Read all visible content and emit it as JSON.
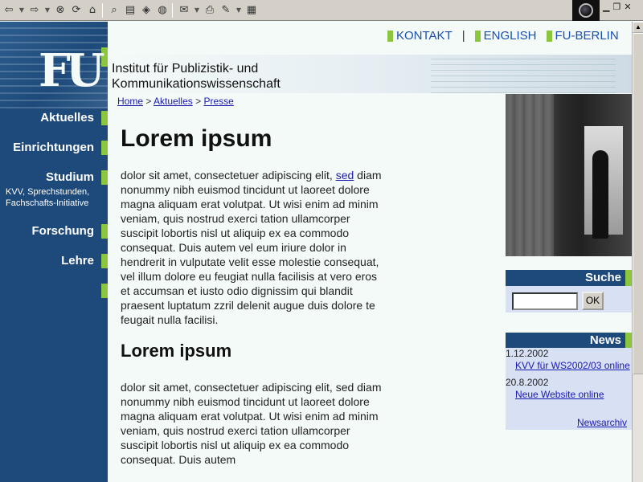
{
  "toolbar": {
    "buttons": [
      "back-icon",
      "forward-icon",
      "stop-icon",
      "reload-icon",
      "home-icon",
      "search-icon",
      "folder-icon",
      "history-icon",
      "mail-icon",
      "edit-icon",
      "print-icon",
      "edit-page-icon",
      "page-icon"
    ]
  },
  "header": {
    "topnav": [
      {
        "label": "KONTAKT"
      },
      {
        "label": "ENGLISH"
      },
      {
        "label": "FU-BERLIN"
      }
    ],
    "logo_text": "FU",
    "institute_line1": "Institut für Publizistik- und",
    "institute_line2": "Kommunikationswissenschaft"
  },
  "breadcrumb": {
    "home": "Home",
    "aktuelles": "Aktuelles",
    "presse": "Presse",
    "sep": ">"
  },
  "sidebar": {
    "items": [
      {
        "label": "Aktuelles"
      },
      {
        "label": "Einrichtungen"
      },
      {
        "label": "Studium",
        "sub1": "KVV, Sprechstunden,",
        "sub2": "Fachschafts-Initiative"
      },
      {
        "label": "Forschung"
      },
      {
        "label": "Lehre"
      }
    ]
  },
  "main": {
    "heading1": "Lorem ipsum",
    "para1_before_link": "dolor sit amet, consectetuer adipiscing elit, ",
    "para1_link": "sed",
    "para1_after_link": " diam nonummy nibh euismod tincidunt ut laoreet dolore magna aliquam erat volutpat. Ut wisi enim ad minim veniam, quis nostrud exerci tation ullamcorper suscipit lobortis nisl ut aliquip ex ea commodo consequat. Duis autem vel eum iriure dolor in hendrerit in vulputate velit esse molestie consequat, vel illum dolore eu feugiat nulla facilisis at vero eros et accumsan et iusto odio dignissim qui blandit praesent luptatum zzril delenit augue duis dolore te feugait nulla facilisi.",
    "heading2": "Lorem ipsum",
    "para2": "dolor sit amet, consectetuer adipiscing elit, sed diam nonummy nibh euismod tincidunt ut laoreet dolore magna aliquam erat volutpat. Ut wisi enim ad minim veniam, quis nostrud exerci tation ullamcorper suscipit lobortis nisl ut aliquip ex ea commodo consequat. Duis autem"
  },
  "search": {
    "title": "Suche",
    "input_value": "",
    "button_label": "OK"
  },
  "news": {
    "title": "News",
    "entries": [
      {
        "date": "1.12.2002",
        "link": "KVV für WS2002/03 online"
      },
      {
        "date": "20.8.2002",
        "link": "Neue Website online"
      }
    ],
    "archive_label": "Newsarchiv"
  },
  "colors": {
    "brand_blue": "#1d4a7a",
    "accent_green": "#8cc63f",
    "link_blue": "#1a1ab0"
  }
}
